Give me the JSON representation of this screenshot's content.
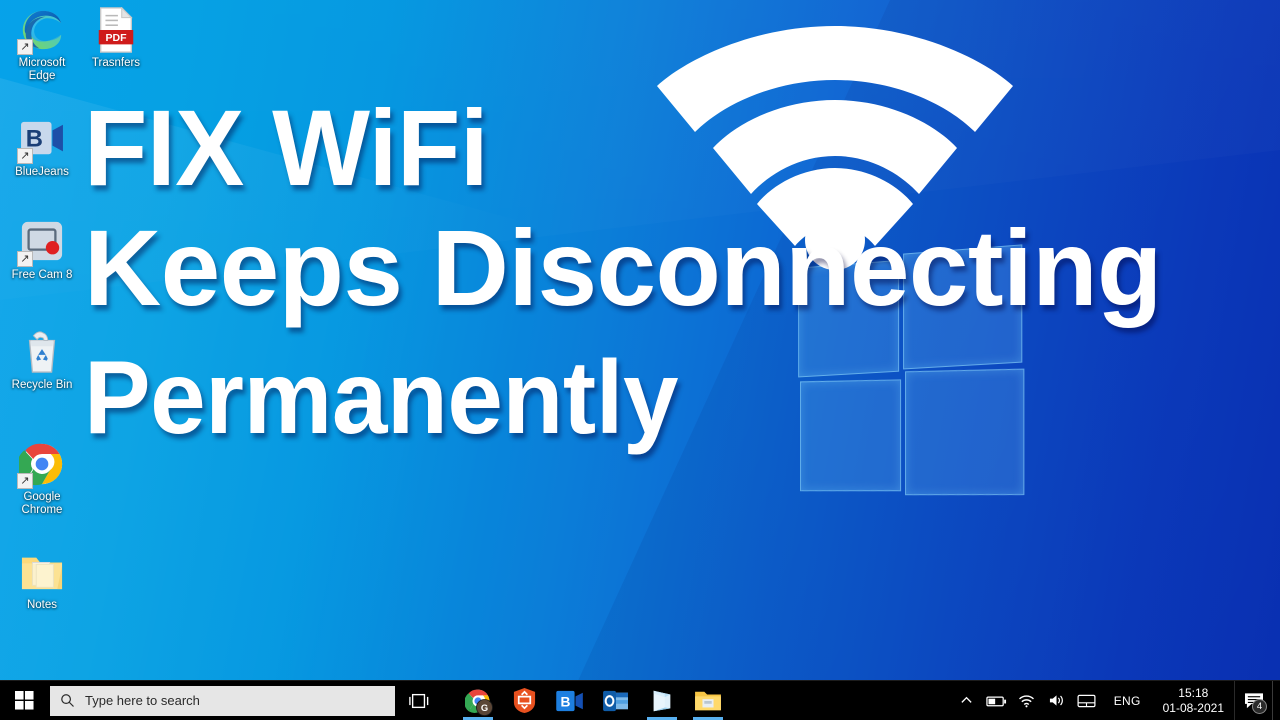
{
  "overlay": {
    "headline_line1": "FIX WiFi",
    "headline_line2": "Keeps Disconnecting",
    "headline_line3": "Permanently",
    "wifi_icon_name": "wifi-signal-icon",
    "text_color": "#ffffff"
  },
  "wallpaper": {
    "name": "windows-10-default-wallpaper",
    "gradient_start": "#00a0e9",
    "gradient_end": "#0a35bd",
    "logo_name": "windows-logo-watermark"
  },
  "desktop": {
    "icons": [
      {
        "label": "Microsoft Edge",
        "icon": "microsoft-edge-icon",
        "shortcut": true
      },
      {
        "label": "Trasnfers",
        "icon": "pdf-file-icon",
        "shortcut": false
      },
      {
        "label": "BlueJeans",
        "icon": "bluejeans-icon",
        "shortcut": true
      },
      {
        "label": "Free Cam 8",
        "icon": "free-cam-8-icon",
        "shortcut": true
      },
      {
        "label": "Recycle Bin",
        "icon": "recycle-bin-icon",
        "shortcut": false
      },
      {
        "label": "Google Chrome",
        "icon": "google-chrome-icon",
        "shortcut": true
      },
      {
        "label": "Notes",
        "icon": "folder-icon",
        "shortcut": false
      }
    ]
  },
  "taskbar": {
    "start_label": "Start",
    "start_icon": "windows-start-icon",
    "search": {
      "placeholder": "Type here to search",
      "icon": "search-icon"
    },
    "task_view_label": "Task View",
    "task_view_icon": "task-view-icon",
    "apps": [
      {
        "label": "Google Chrome",
        "icon": "google-chrome-icon",
        "running": true
      },
      {
        "label": "Antivirus",
        "icon": "shield-icon",
        "running": false
      },
      {
        "label": "BlueJeans",
        "icon": "bluejeans-icon",
        "running": false
      },
      {
        "label": "Outlook",
        "icon": "outlook-icon",
        "running": false
      },
      {
        "label": "OneNote",
        "icon": "onenote-icon",
        "running": true
      },
      {
        "label": "File Explorer",
        "icon": "file-explorer-icon",
        "running": true
      }
    ],
    "tray": {
      "chevron_label": "Show hidden icons",
      "chevron_icon": "chevron-up-icon",
      "battery_icon": "battery-icon",
      "wifi_icon": "wifi-icon",
      "volume_icon": "speaker-icon",
      "touchpad_icon": "touchpad-icon",
      "language": "ENG",
      "time": "15:18",
      "date": "01-08-2021",
      "notification_icon": "notification-icon",
      "notification_count": "4",
      "show_desktop_label": "Show desktop"
    }
  }
}
